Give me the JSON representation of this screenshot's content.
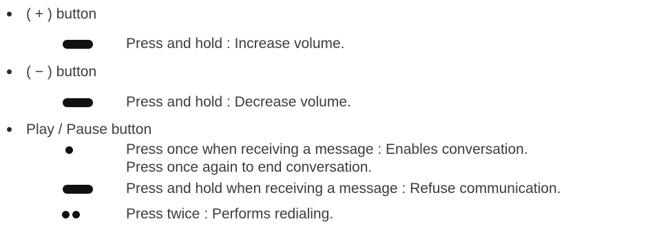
{
  "sections": [
    {
      "heading": "( + ) button",
      "items": [
        {
          "icon": "long-press-icon",
          "lines": [
            "Press and hold : Increase volume."
          ]
        }
      ]
    },
    {
      "heading": "( − ) button",
      "items": [
        {
          "icon": "long-press-icon",
          "lines": [
            "Press and hold : Decrease volume."
          ]
        }
      ]
    },
    {
      "heading": "Play / Pause button",
      "items": [
        {
          "icon": "single-press-icon",
          "lines": [
            "Press once when receiving a message : Enables conversation.",
            "Press once again to end conversation."
          ]
        },
        {
          "icon": "long-press-icon",
          "lines": [
            "Press and hold when receiving a message : Refuse communication."
          ]
        },
        {
          "icon": "double-press-icon",
          "lines": [
            "Press twice : Performs redialing."
          ]
        }
      ]
    }
  ]
}
